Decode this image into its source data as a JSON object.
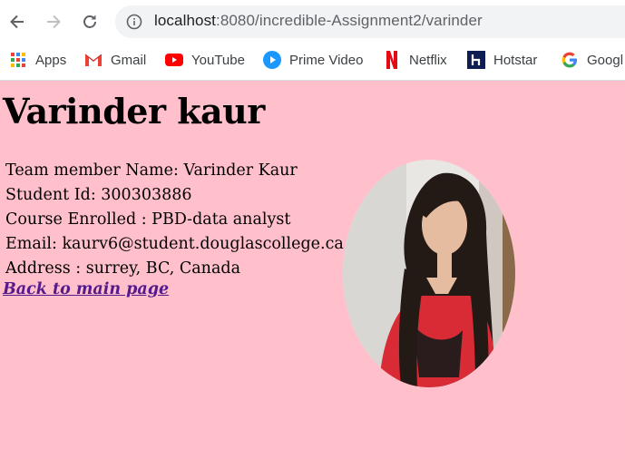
{
  "browser": {
    "url_host": "localhost",
    "url_rest": ":8080/incredible-Assignment2/varinder",
    "bookmarks": [
      {
        "label": "Apps",
        "icon": "apps-grid-icon"
      },
      {
        "label": "Gmail",
        "icon": "gmail-icon"
      },
      {
        "label": "YouTube",
        "icon": "youtube-icon"
      },
      {
        "label": "Prime Video",
        "icon": "prime-video-icon"
      },
      {
        "label": "Netflix",
        "icon": "netflix-icon"
      },
      {
        "label": "Hotstar",
        "icon": "hotstar-icon"
      },
      {
        "label": "Googl",
        "icon": "google-icon"
      }
    ]
  },
  "page": {
    "title": "Varinder kaur",
    "details": [
      "Team member Name: Varinder Kaur",
      "Student Id: 300303886",
      "Course Enrolled : PBD-data analyst",
      "Email: kaurv6@student.douglascollege.ca",
      "Address : surrey, BC, Canada"
    ],
    "back_link": "Back to main page"
  },
  "colors": {
    "page_background": "#ffc0cb",
    "link_visited": "#551a8b"
  }
}
